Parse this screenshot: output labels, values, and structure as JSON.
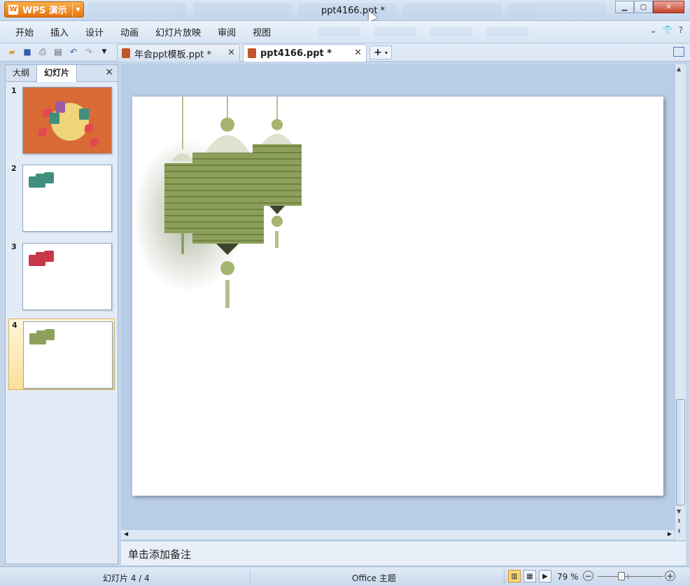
{
  "app": {
    "name": "WPS 演示",
    "doc_title": "ppt4166.ppt *"
  },
  "menu": {
    "items": [
      "开始",
      "插入",
      "设计",
      "动画",
      "幻灯片放映",
      "审阅",
      "视图"
    ]
  },
  "doc_tabs": [
    {
      "label": "年会ppt模板.ppt *",
      "active": false
    },
    {
      "label": "ppt4166.ppt *",
      "active": true
    }
  ],
  "left_panel": {
    "tabs": [
      "大纲",
      "幻灯片"
    ],
    "active_tab": "幻灯片",
    "close": "×",
    "slides": [
      {
        "num": "1",
        "selected": false
      },
      {
        "num": "2",
        "selected": false
      },
      {
        "num": "3",
        "selected": false
      },
      {
        "num": "4",
        "selected": true
      }
    ]
  },
  "notes": {
    "placeholder": "单击添加备注"
  },
  "status": {
    "slide_indicator": "幻灯片 4 / 4",
    "theme": "Office 主题",
    "zoom": "79 %"
  },
  "colors": {
    "lantern_green": "#8da05b",
    "lantern_teal": "#3f8f7c",
    "lantern_red": "#c9374a",
    "slide1_bg": "#d96a35",
    "accent_orange": "#e8720c"
  }
}
